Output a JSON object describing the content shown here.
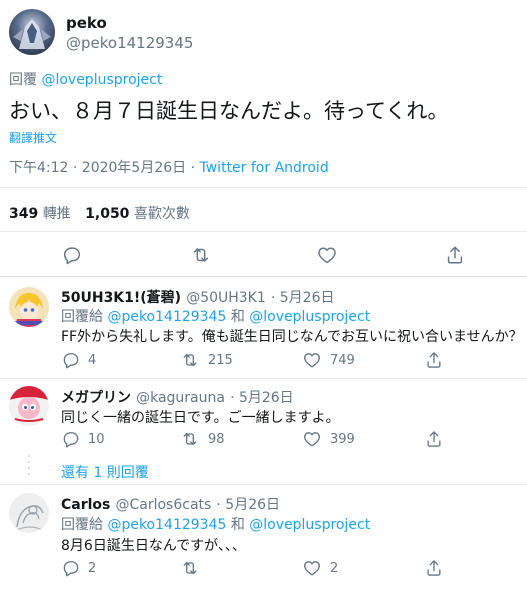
{
  "main_tweet": {
    "display_name": "peko",
    "handle": "@peko14129345",
    "reply_prefix": "回覆",
    "reply_to": "@loveplusproject",
    "text": "おい、８月７日誕生日なんだよ。待ってくれ。",
    "translate_label": "翻譯推文",
    "timestamp": "下午4:12 · 2020年5月26日 · ",
    "source": "Twitter for Android",
    "retweets_count": "349",
    "retweets_label": "轉推",
    "likes_count": "1,050",
    "likes_label": "喜歡次數"
  },
  "replies": [
    {
      "display_name": "50UH3K1!(蒼碧)",
      "handle": "@50UH3K1",
      "date": "· 5月26日",
      "reply_prefix": "回覆給 ",
      "reply_to_1": "@peko14129345",
      "reply_and": " 和 ",
      "reply_to_2": "@loveplusproject",
      "text": "FF外から失礼します。俺も誕生日同じなんでお互いに祝い合いませんか？",
      "reply_count": "4",
      "retweet_count": "215",
      "like_count": "749"
    },
    {
      "display_name": "メガプリン",
      "handle": "@kagurauna",
      "date": "· 5月26日",
      "text": "同じく一緒の誕生日です。ご一緒しますよ。",
      "reply_count": "10",
      "retweet_count": "98",
      "like_count": "399",
      "more_replies": "還有 1 則回覆"
    },
    {
      "display_name": "Carlos",
      "handle": "@Carlos6cats",
      "date": "· 5月26日",
      "reply_prefix": "回覆給 ",
      "reply_to_1": "@peko14129345",
      "reply_and": " 和 ",
      "reply_to_2": "@loveplusproject",
      "text": "8月6日誕生日なんですが、、、",
      "reply_count": "2",
      "retweet_count": "",
      "like_count": "2"
    }
  ],
  "icons": {
    "reply": "reply-icon",
    "retweet": "retweet-icon",
    "like": "like-icon",
    "share": "share-icon"
  },
  "colors": {
    "link": "#1da1f2",
    "secondary_text": "#657786",
    "divider": "#e6ecf0"
  }
}
